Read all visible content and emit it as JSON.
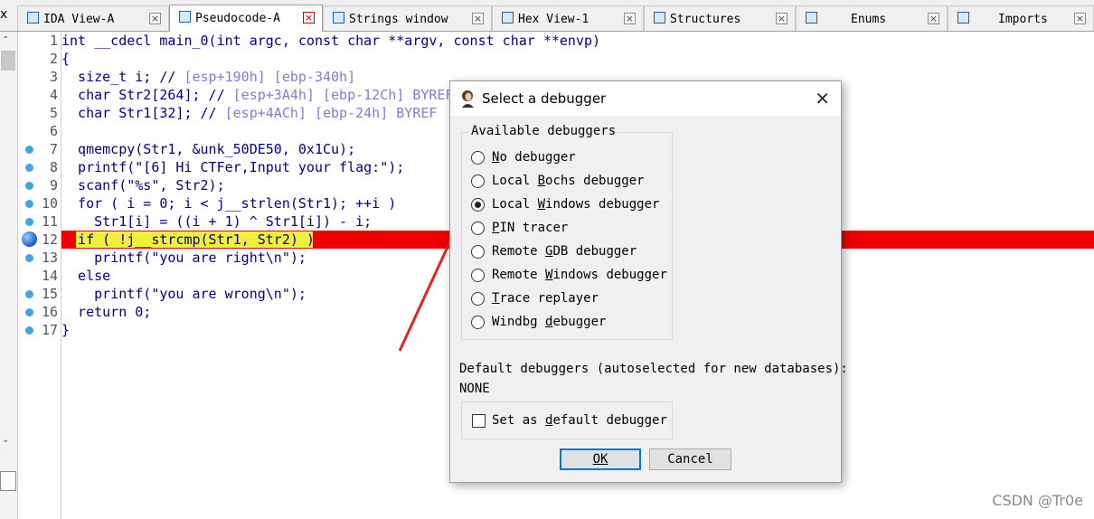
{
  "tabs": [
    {
      "label": "IDA View-A",
      "active": false,
      "icon": "ida-view-icon"
    },
    {
      "label": "Pseudocode-A",
      "active": true,
      "icon": "pseudocode-icon"
    },
    {
      "label": "Strings window",
      "active": false,
      "icon": "strings-icon"
    },
    {
      "label": "Hex View-1",
      "active": false,
      "icon": "hex-icon"
    },
    {
      "label": "Structures",
      "active": false,
      "icon": "structures-icon"
    },
    {
      "label": "Enums",
      "active": false,
      "icon": "enums-icon"
    },
    {
      "label": "Imports",
      "active": false,
      "icon": "imports-icon"
    }
  ],
  "tab_close_glyph": "×",
  "left_x": "x",
  "code": {
    "lines": [
      {
        "n": "1",
        "dot": false
      },
      {
        "n": "2",
        "dot": false
      },
      {
        "n": "3",
        "dot": false
      },
      {
        "n": "4",
        "dot": false
      },
      {
        "n": "5",
        "dot": false
      },
      {
        "n": "6",
        "dot": false
      },
      {
        "n": "7",
        "dot": true
      },
      {
        "n": "8",
        "dot": true
      },
      {
        "n": "9",
        "dot": true
      },
      {
        "n": "10",
        "dot": true
      },
      {
        "n": "11",
        "dot": true
      },
      {
        "n": "12",
        "dot": "breakpoint"
      },
      {
        "n": "13",
        "dot": true
      },
      {
        "n": "14",
        "dot": false
      },
      {
        "n": "15",
        "dot": true
      },
      {
        "n": "16",
        "dot": true
      },
      {
        "n": "17",
        "dot": true
      }
    ],
    "l1": "int __cdecl main_0(int argc, const char **argv, const char **envp)",
    "l2": "{",
    "l3a": "  size_t i; // ",
    "l3b": "[esp+190h] [ebp-340h]",
    "l4a": "  char Str2[264]; // ",
    "l4b": "[esp+3A4h] [ebp-12Ch] BYREF",
    "l5a": "  char Str1[32]; // ",
    "l5b": "[esp+4ACh] [ebp-24h] BYREF",
    "l6": "",
    "l7": "  qmemcpy(Str1, &unk_50DE50, 0x1Cu);",
    "l8": "  printf(\"[6] Hi CTFer,Input your flag:\");",
    "l9": "  scanf(\"%s\", Str2);",
    "l10": "  for ( i = 0; i < j__strlen(Str1); ++i )",
    "l11": "    Str1[i] = ((i + 1) ^ Str1[i]) - i;",
    "l12": "  if ( !j__strcmp(Str1, Str2) )",
    "l13": "    printf(\"you are right\\n\");",
    "l14": "  else",
    "l15": "    printf(\"you are wrong\\n\");",
    "l16": "  return 0;",
    "l17": "}"
  },
  "dialog": {
    "title": "Select a debugger",
    "close_glyph": "✕",
    "group_label": "Available debuggers",
    "options": [
      {
        "pre": "",
        "u": "N",
        "post": "o debugger",
        "checked": false
      },
      {
        "pre": "Local ",
        "u": "B",
        "post": "ochs debugger",
        "checked": false
      },
      {
        "pre": "Local ",
        "u": "W",
        "post": "indows debugger",
        "checked": true
      },
      {
        "pre": "",
        "u": "P",
        "post": "IN tracer",
        "checked": false
      },
      {
        "pre": "Remote ",
        "u": "G",
        "post": "DB debugger",
        "checked": false
      },
      {
        "pre": "Remote ",
        "u": "W",
        "post": "indows debugger",
        "checked": false
      },
      {
        "pre": "",
        "u": "T",
        "post": "race replayer",
        "checked": false
      },
      {
        "pre": "Windbg ",
        "u": "d",
        "post": "ebugger",
        "checked": false
      }
    ],
    "default_label": "Default debuggers (autoselected for new databases):",
    "default_value": "NONE",
    "checkbox_pre": "Set as ",
    "checkbox_u": "d",
    "checkbox_post": "efault debugger",
    "checkbox_checked": false,
    "ok_label": "OK",
    "cancel_label": "Cancel"
  },
  "watermark": "CSDN @Tr0e",
  "colors": {
    "breakpoint_bar": "#ee0000",
    "highlight": "#f0f03c",
    "arrow": "#e8231e",
    "accent": "#0078d7"
  }
}
